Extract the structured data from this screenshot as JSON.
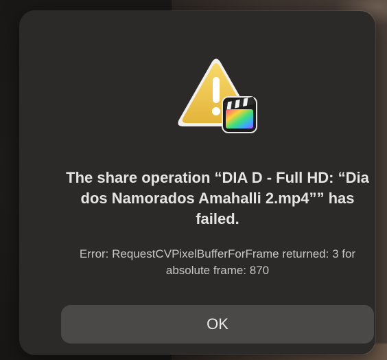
{
  "alert": {
    "title": "The share operation “DIA D - Full HD: “Dia dos Namorados Amahalli 2.mp4”” has failed.",
    "message": "Error: RequestCVPixelBufferForFrame returned: 3 for absolute frame: 870",
    "ok_label": "OK",
    "icon": "warning-icon",
    "badge_icon": "final-cut-pro-icon"
  },
  "colors": {
    "dialog_bg": "#2c2a29",
    "button_bg": "#4b4948",
    "warning_yellow": "#f2c94c"
  }
}
